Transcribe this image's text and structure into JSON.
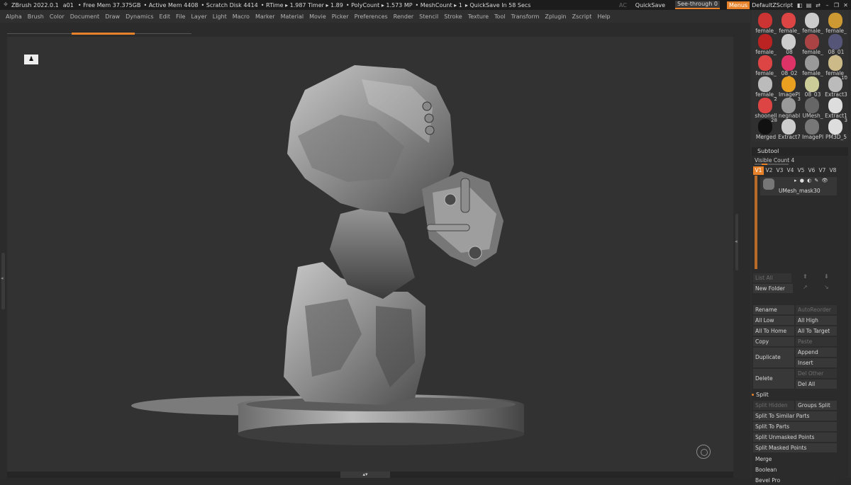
{
  "titlebar": {
    "app": "ZBrush 2022.0.1",
    "doc": "a01",
    "free_mem": "• Free Mem 37.375GB",
    "active_mem": "• Active Mem 4408",
    "scratch": "• Scratch Disk 4414",
    "rtime": "• RTime ▸ 1.987 Timer ▸ 1.89",
    "polycount": "• PolyCount ▸ 1.573 MP",
    "meshcount": "• MeshCount ▸ 1",
    "quicksave_in": "▸ QuickSave In 58 Secs",
    "ac": "AC",
    "quicksave": "QuickSave",
    "seethrough_label": "See-through",
    "seethrough_value": "0",
    "menus": "Menus",
    "script": "DefaultZScript"
  },
  "menubar": [
    "Alpha",
    "Brush",
    "Color",
    "Document",
    "Draw",
    "Dynamics",
    "Edit",
    "File",
    "Layer",
    "Light",
    "Macro",
    "Marker",
    "Material",
    "Movie",
    "Picker",
    "Preferences",
    "Render",
    "Stencil",
    "Stroke",
    "Texture",
    "Tool",
    "Transform",
    "Zplugin",
    "Zscript",
    "Help"
  ],
  "tool_thumbs": [
    {
      "label": "female_",
      "color": "#c33"
    },
    {
      "label": "female_",
      "color": "#d44"
    },
    {
      "label": "female_",
      "color": "#ccc"
    },
    {
      "label": "female_",
      "color": "#c93"
    },
    {
      "label": "female_",
      "color": "#b22"
    },
    {
      "label": "08",
      "color": "#ccc"
    },
    {
      "label": "female_",
      "color": "#a44"
    },
    {
      "label": "08_01",
      "color": "#557"
    },
    {
      "label": "female_",
      "color": "#d44"
    },
    {
      "label": "08_02",
      "color": "#d36"
    },
    {
      "label": "female_",
      "color": "#999"
    },
    {
      "label": "female_",
      "color": "#cb8"
    },
    {
      "label": "female_",
      "color": "#bbb"
    },
    {
      "label": "ImagePl",
      "color": "#e9a020"
    },
    {
      "label": "08_03",
      "color": "#cc9"
    },
    {
      "label": "Extract3",
      "color": "#bbb"
    },
    {
      "label": "shoonell",
      "color": "#d44"
    },
    {
      "label": "negnabl",
      "color": "#999"
    },
    {
      "label": "UMesh_",
      "color": "#666"
    },
    {
      "label": "Extract1",
      "color": "#ddd"
    },
    {
      "label": "Merged",
      "color": "#111"
    },
    {
      "label": "Extract7",
      "color": "#ccc"
    },
    {
      "label": "ImagePl",
      "color": "#777"
    },
    {
      "label": "PM3D_5",
      "color": "#ddd"
    }
  ],
  "thumb_counts": {
    "extract3": "10",
    "shoonell": "2",
    "negnabl": "3",
    "merged": "28",
    "pm3d": "3"
  },
  "subtool": {
    "title": "Subtool",
    "visible_count": "Visible Count 4",
    "vtabs": [
      "V1",
      "V2",
      "V3",
      "V4",
      "V5",
      "V6",
      "V7",
      "V8"
    ],
    "item_name": "UMesh_mask30",
    "item_icons": "▸ ● ◐ ✎ 👁",
    "list_all": "List All",
    "new_folder": "New Folder",
    "rename": "Rename",
    "autoreorder": "AutoReorder",
    "all_low": "All Low",
    "all_high": "All High",
    "all_to_home": "All To Home",
    "all_to_target": "All To Target",
    "copy": "Copy",
    "paste": "Paste",
    "duplicate": "Duplicate",
    "append": "Append",
    "insert": "Insert",
    "delete": "Delete",
    "del_other": "Del Other",
    "del_all": "Del All",
    "split": "Split",
    "split_hidden": "Split Hidden",
    "groups_split": "Groups Split",
    "split_similar": "Split To Similar Parts",
    "split_parts": "Split To Parts",
    "split_unmasked": "Split Unmasked Points",
    "split_masked": "Split Masked Points",
    "merge": "Merge",
    "boolean": "Boolean",
    "bevel_pro": "Bevel Pro"
  }
}
